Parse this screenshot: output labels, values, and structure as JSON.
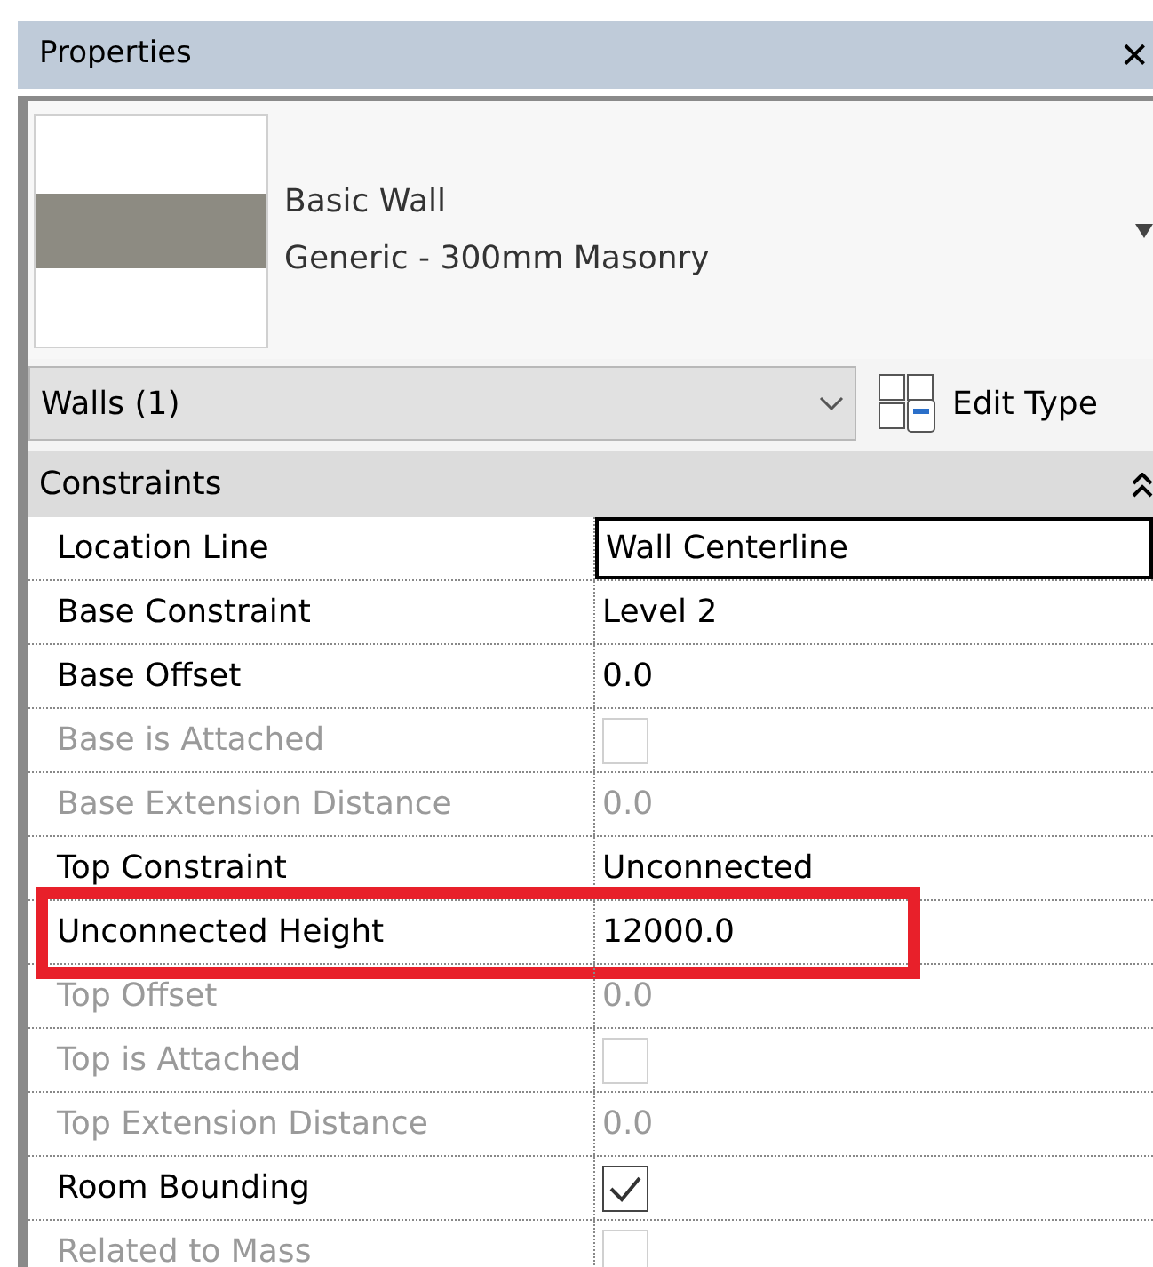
{
  "panel": {
    "title": "Properties",
    "close": "✕"
  },
  "type_selector": {
    "family": "Basic Wall",
    "type": "Generic - 300mm Masonry"
  },
  "filter": {
    "value": "Walls (1)",
    "edit_type": "Edit Type"
  },
  "group": {
    "title": "Constraints",
    "expanded": true
  },
  "rows": [
    {
      "label": "Location Line",
      "kind": "text",
      "value": "Wall Centerline",
      "disabled": false,
      "selected": true,
      "highlighted": false
    },
    {
      "label": "Base Constraint",
      "kind": "text",
      "value": "Level 2",
      "disabled": false,
      "selected": false,
      "highlighted": false
    },
    {
      "label": "Base Offset",
      "kind": "text",
      "value": "0.0",
      "disabled": false,
      "selected": false,
      "highlighted": false
    },
    {
      "label": "Base is Attached",
      "kind": "checkbox",
      "checked": false,
      "disabled": true,
      "selected": false,
      "highlighted": false
    },
    {
      "label": "Base Extension Distance",
      "kind": "text",
      "value": "0.0",
      "disabled": true,
      "selected": false,
      "highlighted": false
    },
    {
      "label": "Top Constraint",
      "kind": "text",
      "value": "Unconnected",
      "disabled": false,
      "selected": false,
      "highlighted": false
    },
    {
      "label": "Unconnected Height",
      "kind": "text",
      "value": "12000.0",
      "disabled": false,
      "selected": false,
      "highlighted": true
    },
    {
      "label": "Top Offset",
      "kind": "text",
      "value": "0.0",
      "disabled": true,
      "selected": false,
      "highlighted": false
    },
    {
      "label": "Top is Attached",
      "kind": "checkbox",
      "checked": false,
      "disabled": true,
      "selected": false,
      "highlighted": false
    },
    {
      "label": "Top Extension Distance",
      "kind": "text",
      "value": "0.0",
      "disabled": true,
      "selected": false,
      "highlighted": false
    },
    {
      "label": "Room Bounding",
      "kind": "checkbox",
      "checked": true,
      "disabled": false,
      "selected": false,
      "highlighted": false
    },
    {
      "label": "Related to Mass",
      "kind": "checkbox",
      "checked": false,
      "disabled": true,
      "selected": false,
      "highlighted": false
    }
  ]
}
